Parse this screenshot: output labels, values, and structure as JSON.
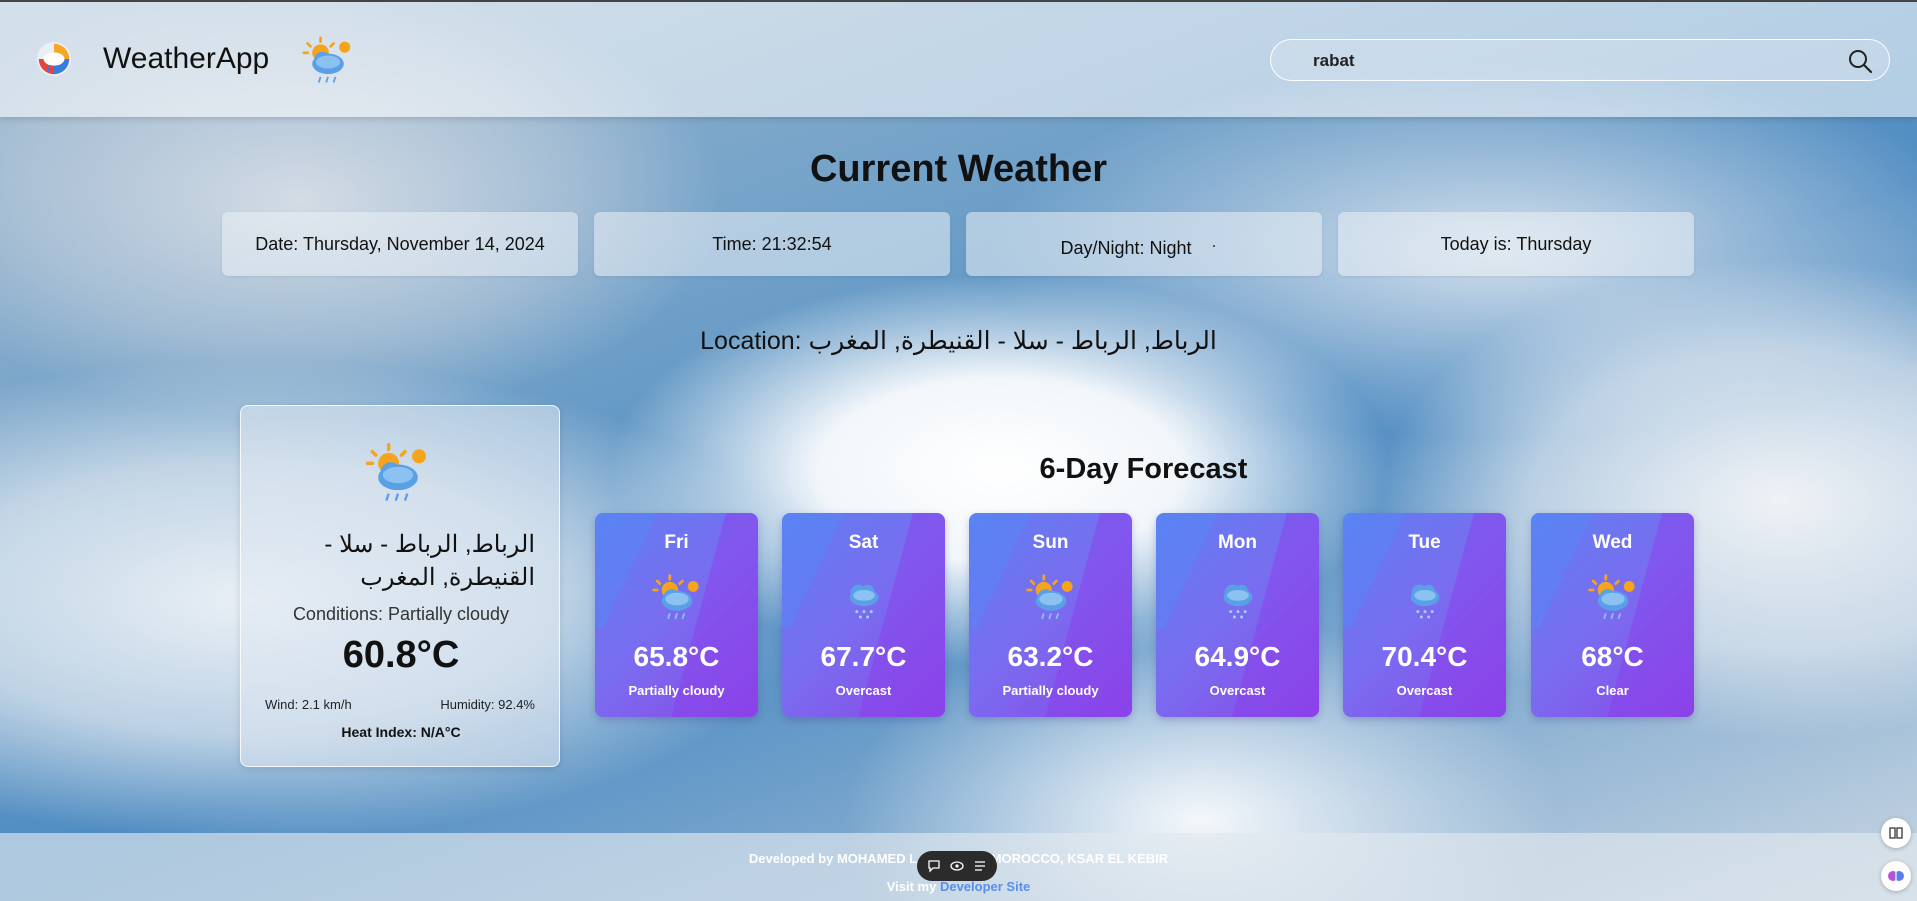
{
  "header": {
    "app_title": "WeatherApp",
    "search_value": "rabat",
    "search_placeholder": ""
  },
  "current_section": {
    "title": "Current Weather",
    "date_text": "Date: Thursday, November 14, 2024",
    "time_text": "Time: 21:32:54",
    "day_night_text": "Day/Night: Night",
    "today_text": "Today is: Thursday",
    "location_text": "Location: الرباط, الرباط - سلا - القنيطرة, المغرب"
  },
  "current_card": {
    "location": "الرباط, الرباط - سلا - القنيطرة, المغرب",
    "conditions": "Conditions: Partially cloudy",
    "temperature": "60.8°C",
    "wind": "Wind: 2.1 km/h",
    "humidity": "Humidity: 92.4%",
    "heat_index": "Heat Index: N/A°C",
    "icon": "partly-cloudy-rain-icon"
  },
  "forecast": {
    "title": "6-Day Forecast",
    "days": [
      {
        "day": "Fri",
        "temp": "65.8°C",
        "condition": "Partially cloudy",
        "icon": "partly-cloudy-rain-icon"
      },
      {
        "day": "Sat",
        "temp": "67.7°C",
        "condition": "Overcast",
        "icon": "cloud-snow-icon"
      },
      {
        "day": "Sun",
        "temp": "63.2°C",
        "condition": "Partially cloudy",
        "icon": "partly-cloudy-rain-icon"
      },
      {
        "day": "Mon",
        "temp": "64.9°C",
        "condition": "Overcast",
        "icon": "cloud-snow-icon"
      },
      {
        "day": "Tue",
        "temp": "70.4°C",
        "condition": "Overcast",
        "icon": "cloud-snow-icon"
      },
      {
        "day": "Wed",
        "temp": "68°C",
        "condition": "Clear",
        "icon": "partly-cloudy-rain-icon"
      }
    ]
  },
  "footer": {
    "line1_prefix": "Developed by MOHAMED L",
    "line1_suffix": "n MOROCCO, KSAR EL KEBIR",
    "line2_prefix": "Visit my ",
    "link_text": "Developer Site"
  },
  "colors": {
    "forecast_gradient_start": "#5f7ff0",
    "forecast_gradient_end": "#8b46e6",
    "link": "#5a8fe6"
  }
}
